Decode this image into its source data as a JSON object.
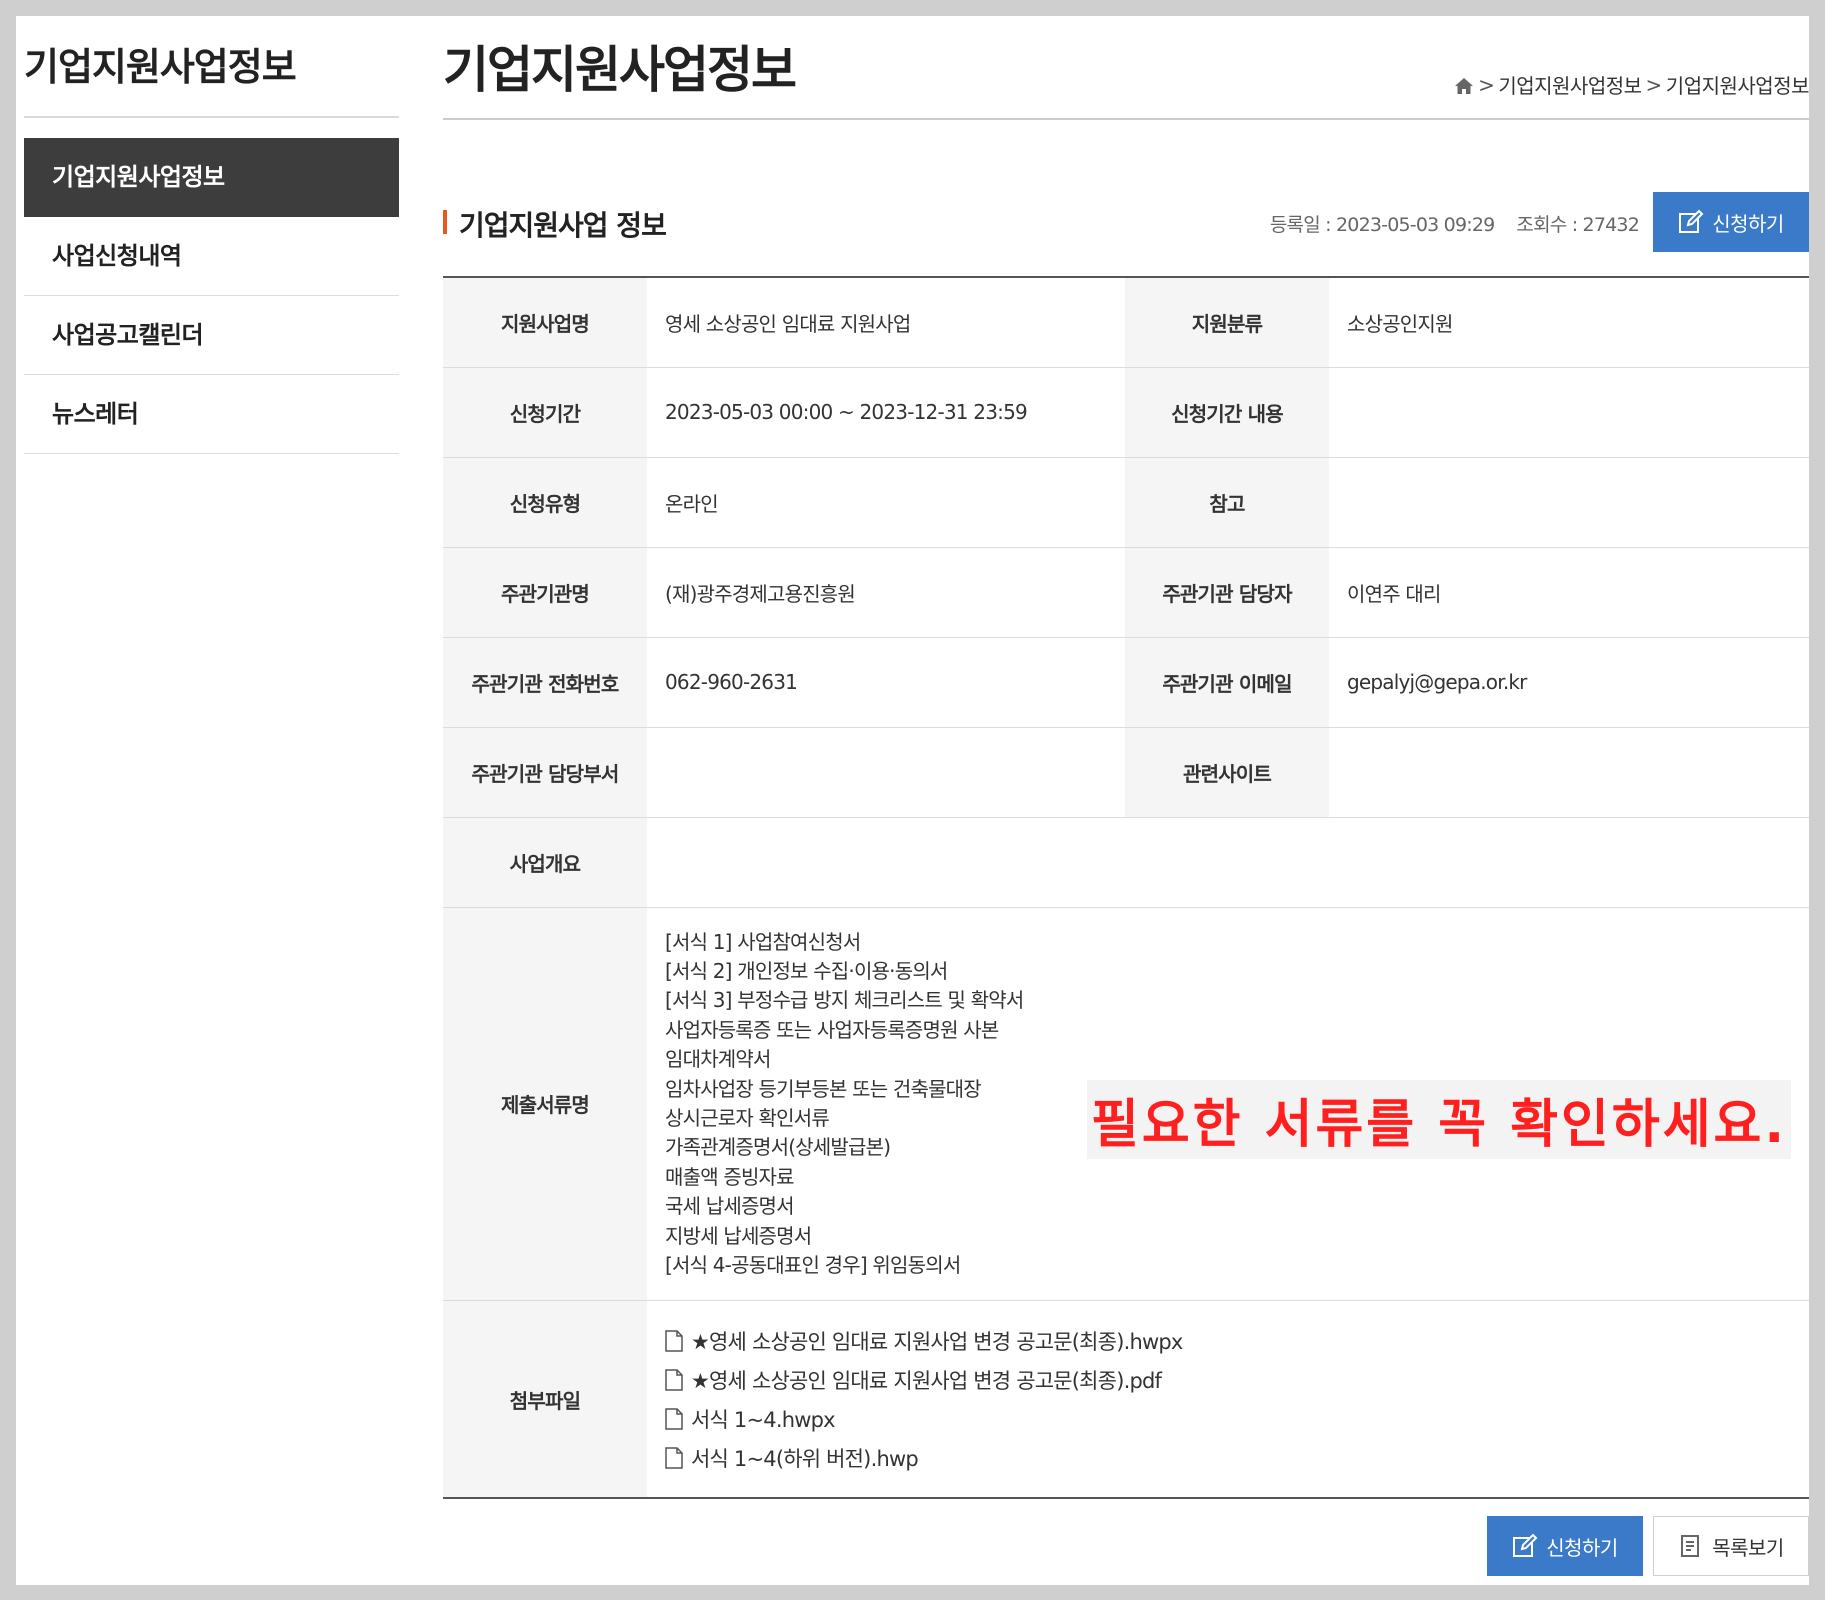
{
  "sidebar": {
    "title": "기업지원사업정보",
    "items": [
      {
        "label": "기업지원사업정보"
      },
      {
        "label": "사업신청내역"
      },
      {
        "label": "사업공고캘린더"
      },
      {
        "label": "뉴스레터"
      }
    ]
  },
  "header": {
    "title": "기업지원사업정보",
    "breadcrumb": [
      "기업지원사업정보",
      "기업지원사업정보"
    ]
  },
  "section": {
    "title": "기업지원사업 정보",
    "reg_date": "등록일 : 2023-05-03 09:29",
    "views": "조회수 : 27432",
    "apply_label": "신청하기"
  },
  "table": {
    "support_name_label": "지원사업명",
    "support_name": "영세 소상공인 임대료 지원사업",
    "category_label": "지원분류",
    "category": "소상공인지원",
    "period_label": "신청기간",
    "period": "2023-05-03 00:00 ~ 2023-12-31 23:59",
    "period_detail_label": "신청기간 내용",
    "period_detail": "",
    "apply_type_label": "신청유형",
    "apply_type": "온라인",
    "reference_label": "참고",
    "reference": "",
    "org_label": "주관기관명",
    "org": "(재)광주경제고용진흥원",
    "manager_label": "주관기관 담당자",
    "manager": "이연주 대리",
    "phone_label": "주관기관 전화번호",
    "phone": "062-960-2631",
    "email_label": "주관기관 이메일",
    "email": "gepalyj@gepa.or.kr",
    "dept_label": "주관기관 담당부서",
    "dept": "",
    "site_label": "관련사이트",
    "site": "",
    "overview_label": "사업개요",
    "overview": "",
    "docs_label": "제출서류명",
    "docs": [
      "[서식 1] 사업참여신청서",
      "[서식 2] 개인정보 수집·이용·동의서",
      "[서식 3] 부정수급 방지 체크리스트 및 확약서",
      "사업자등록증 또는 사업자등록증명원 사본",
      "임대차계약서",
      "임차사업장 등기부등본 또는 건축물대장",
      "상시근로자 확인서류",
      "가족관계증명서(상세발급본)",
      "매출액 증빙자료",
      "국세 납세증명서",
      "지방세 납세증명서",
      "[서식 4-공동대표인 경우] 위임동의서"
    ],
    "notice": "필요한 서류를 꼭 확인하세요.",
    "files_label": "첨부파일",
    "files": [
      "★영세 소상공인 임대료 지원사업 변경 공고문(최종).hwpx",
      "★영세 소상공인 임대료 지원사업 변경 공고문(최종).pdf",
      "서식 1~4.hwpx",
      "서식 1~4(하위 버전).hwp"
    ]
  },
  "buttons": {
    "apply": "신청하기",
    "list": "목록보기"
  },
  "colors": {
    "accent": "#3a7ac8",
    "sidebar_active": "#3d3d3d",
    "title_bar": "#e8581c",
    "notice_text": "#ff1f1f"
  },
  "icons": [
    "home-icon",
    "edit-icon",
    "file-icon",
    "list-icon"
  ]
}
